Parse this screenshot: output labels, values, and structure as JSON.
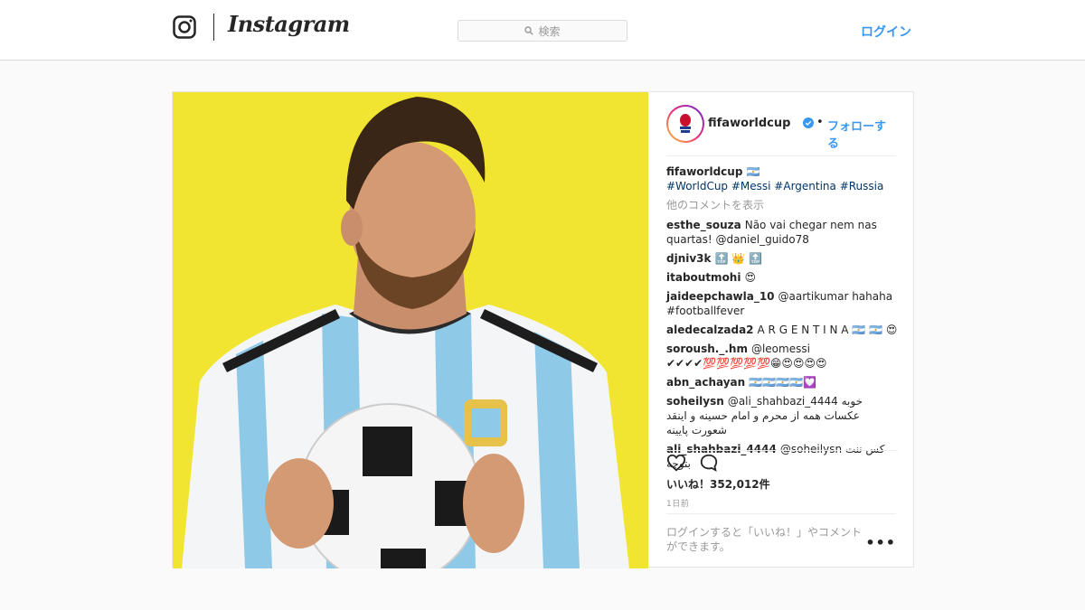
{
  "app": {
    "wordmark": "Instagram"
  },
  "search": {
    "placeholder": "検索"
  },
  "nav": {
    "login": "ログイン"
  },
  "post": {
    "username": "fifaworldcup",
    "dot": "•",
    "follow": "フォローする",
    "caption": {
      "user": "fifaworldcup 🇦🇷",
      "text": "#WorldCup #Messi #Argentina #Russia"
    },
    "show_more": "他のコメントを表示",
    "comments": [
      {
        "user": "esthe_souza",
        "text": "Não vai chegar nem nas quartas! @daniel_guido78"
      },
      {
        "user": "djniv3k",
        "text": "🔝 👑 🔝"
      },
      {
        "user": "itaboutmohi",
        "text": "😍"
      },
      {
        "user": "jaideepchawla_10",
        "text": "@aartikumar hahaha #footballfever"
      },
      {
        "user": "aledecalzada2",
        "text": "A R G E N T I N A 🇦🇷 🇦🇷 😍"
      },
      {
        "user": "soroush._.hm",
        "text": "@leomessi ✔✔✔✔💯💯💯💯💯😁😍😍😍😍"
      },
      {
        "user": "abn_achayan",
        "text": "🇦🇷🇦🇷🇦🇷🇦🇷💟"
      },
      {
        "user": "soheilysn",
        "text": "@ali_shahbazi_4444 خوبه عکسات همه از محرم و امام حسینه و اینقد شعورت پایینه"
      },
      {
        "user": "ali_shahbazi_4444",
        "text": "@soheilysn کس ننت بتوچه"
      }
    ],
    "likes": "いいね！352,012件",
    "ago": "1日前",
    "login_note": "ログインすると「いいね！」やコメントができます。",
    "more_options": "•••"
  },
  "colors": {
    "accent": "#3897f0",
    "photo_bg": "#f2e531"
  },
  "icons": [
    "instagram-logo-icon",
    "search-icon",
    "verified-badge-icon",
    "heart-icon",
    "comment-icon",
    "more-options-icon"
  ]
}
